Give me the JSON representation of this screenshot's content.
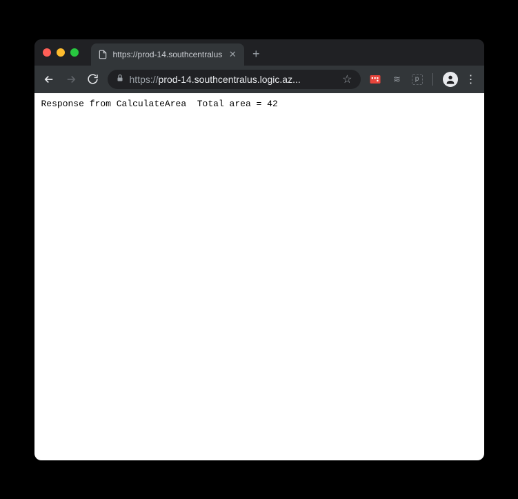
{
  "tab": {
    "title": "https://prod-14.southcentralus"
  },
  "omnibox": {
    "scheme": "https://",
    "rest": "prod-14.southcentralus.logic.az..."
  },
  "page": {
    "body_text": "Response from CalculateArea  Total area = 42"
  },
  "icons": {
    "newtab_glyph": "+",
    "close_glyph": "✕",
    "star_glyph": "☆",
    "menu_glyph": "⋮",
    "buffer_glyph": "≋",
    "pocket_glyph": "p"
  }
}
